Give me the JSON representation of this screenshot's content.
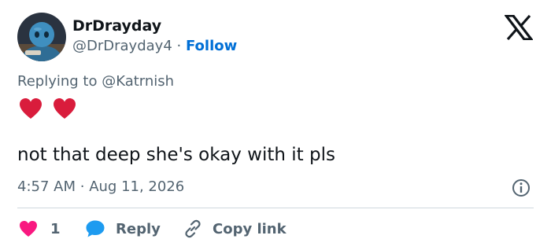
{
  "author": {
    "name": "DrDrayday",
    "handle": "@DrDrayday4",
    "separator": "·",
    "follow_label": "Follow"
  },
  "reply_context": {
    "prefix": "Replying to",
    "mention": "@Katrnish"
  },
  "tweet": {
    "emoji": [
      "heart",
      "heart"
    ],
    "text": "not that deep she's okay with it pls",
    "time": "4:57 AM",
    "separator": "·",
    "date": "Aug 11, 2026"
  },
  "actions": {
    "like_count": "1",
    "reply_label": "Reply",
    "copy_link_label": "Copy link"
  },
  "colors": {
    "heart_red": "#d91c3c",
    "like_pink": "#f91880",
    "reply_blue": "#1d9bf0",
    "follow_blue": "#006fd6",
    "secondary_text": "#536471"
  }
}
